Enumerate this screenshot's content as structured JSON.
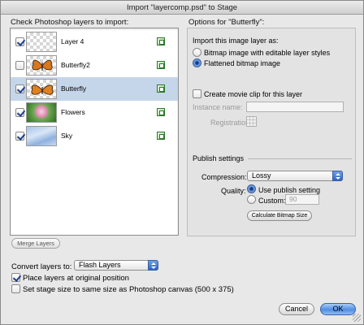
{
  "window": {
    "title": "Import \"layercomp.psd\" to Stage"
  },
  "layers_panel": {
    "heading": "Check Photoshop layers to import:",
    "layers": [
      {
        "name": "Layer 4",
        "checked": true,
        "selected": false,
        "thumb": "checker"
      },
      {
        "name": "Butterfly2",
        "checked": false,
        "selected": false,
        "thumb": "butterfly"
      },
      {
        "name": "Butterfly",
        "checked": true,
        "selected": true,
        "thumb": "butterfly"
      },
      {
        "name": "Flowers",
        "checked": true,
        "selected": false,
        "thumb": "flowers"
      },
      {
        "name": "Sky",
        "checked": true,
        "selected": false,
        "thumb": "sky"
      }
    ],
    "merge_button": "Merge Layers"
  },
  "options": {
    "heading": "Options for \"Butterfly\":",
    "import_as_label": "Import this image layer as:",
    "import_as_options": [
      {
        "label": "Bitmap image with editable layer styles",
        "selected": false
      },
      {
        "label": "Flattened bitmap image",
        "selected": true
      }
    ],
    "movie_clip_label": "Create movie clip for this layer",
    "movie_clip_checked": false,
    "instance_name_label": "Instance name:",
    "instance_name_value": "",
    "registration_label": "Registration:",
    "publish_settings_label": "Publish settings",
    "compression_label": "Compression:",
    "compression_value": "Lossy",
    "quality_label": "Quality:",
    "quality_options": [
      {
        "label": "Use publish setting",
        "selected": true
      },
      {
        "label": "Custom:",
        "selected": false
      }
    ],
    "custom_quality_value": "90",
    "calculate_button": "Calculate Bitmap Size"
  },
  "bottom": {
    "convert_label": "Convert layers to:",
    "convert_value": "Flash Layers",
    "place_layers_label": "Place layers at original position",
    "place_layers_checked": true,
    "stage_size_label": "Set stage size to same size as Photoshop canvas (500 x 375)",
    "stage_size_checked": false
  },
  "buttons": {
    "cancel": "Cancel",
    "ok": "OK"
  },
  "colors": {
    "selection": "#c5d5ea",
    "accent": "#4f8ee4",
    "dialog_bg": "#e8e8e8"
  }
}
